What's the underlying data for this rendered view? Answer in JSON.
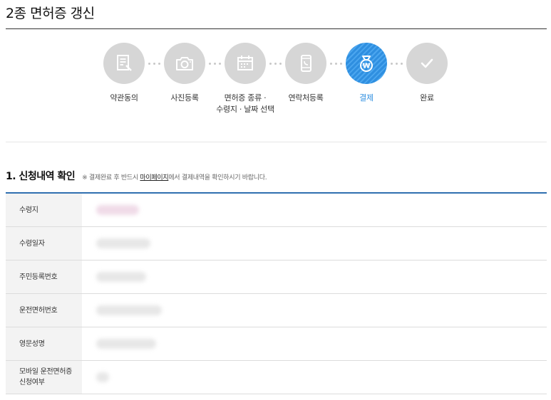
{
  "page": {
    "title": "2종 면허증 갱신"
  },
  "steps": [
    {
      "id": "terms",
      "label_line1": "약관동의",
      "label_line2": "",
      "icon": "document-icon",
      "active": false
    },
    {
      "id": "photo",
      "label_line1": "사진등록",
      "label_line2": "",
      "icon": "camera-icon",
      "active": false
    },
    {
      "id": "license",
      "label_line1": "면허증 종류 ·",
      "label_line2": "수령지 · 날짜 선택",
      "icon": "calendar-icon",
      "active": false
    },
    {
      "id": "contact",
      "label_line1": "연락처등록",
      "label_line2": "",
      "icon": "phone-icon",
      "active": false
    },
    {
      "id": "payment",
      "label_line1": "결제",
      "label_line2": "",
      "icon": "money-bag-icon",
      "active": true
    },
    {
      "id": "complete",
      "label_line1": "완료",
      "label_line2": "",
      "icon": "check-icon",
      "active": false
    }
  ],
  "section1": {
    "title": "1. 신청내역 확인",
    "note_prefix": "※ 결제완료 후 반드시 ",
    "note_link": "마이페이지",
    "note_suffix": "에서 결제내역을 확인하시기 바랍니다."
  },
  "table": {
    "rows": [
      {
        "label": "수령지",
        "value": ""
      },
      {
        "label": "수령일자",
        "value": ""
      },
      {
        "label": "주민등록번호",
        "value": ""
      },
      {
        "label": "운전면허번호",
        "value": ""
      },
      {
        "label": "영문성명",
        "value": ""
      },
      {
        "label_line1": "모바일 운전면허증",
        "label_line2": "신청여부",
        "value": ""
      }
    ]
  },
  "colors": {
    "accent": "#2f8fe0",
    "step_inactive": "#d6d6d6",
    "table_top_border": "#2f6fb0"
  }
}
